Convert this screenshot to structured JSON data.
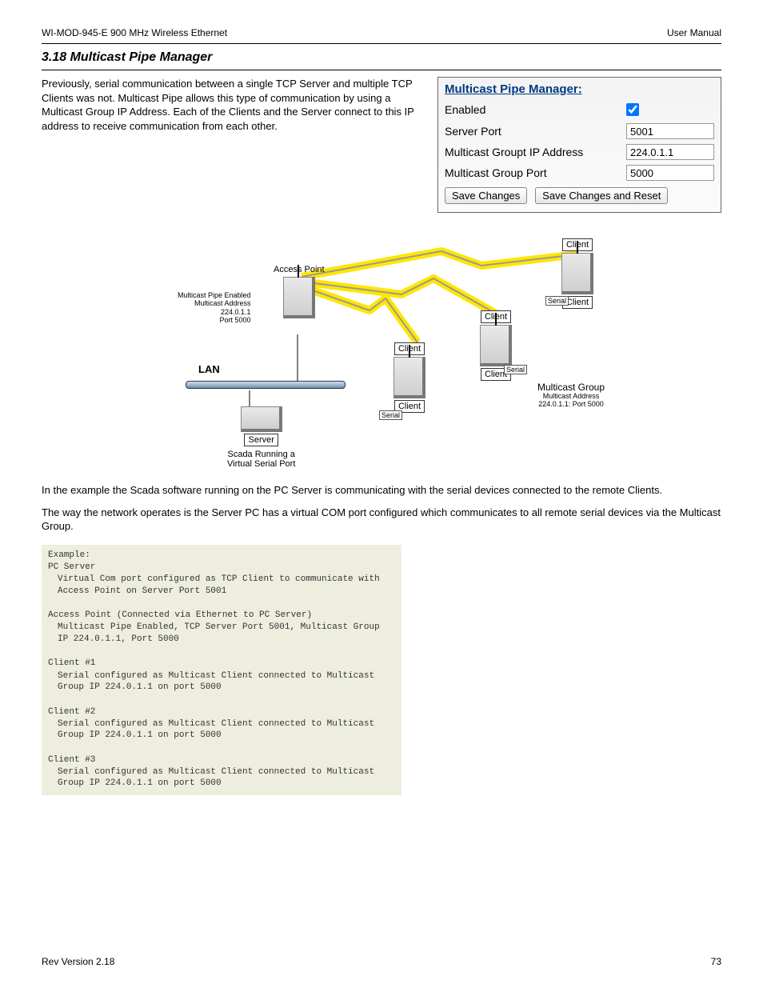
{
  "header": {
    "left": "WI-MOD-945-E 900 MHz Wireless Ethernet",
    "right": "User Manual"
  },
  "section_title": "3.18 Multicast Pipe Manager",
  "intro_para": "Previously, serial communication between a single TCP Server and multiple TCP Clients was not. Multicast Pipe allows this type of communication by using a Multicast Group IP Address. Each of the Clients and the Server connect to this IP address to receive communication from each other.",
  "config_panel": {
    "title": "Multicast Pipe Manager:",
    "enabled_label": "Enabled",
    "enabled_checked": true,
    "server_port_label": "Server Port",
    "server_port_value": "5001",
    "group_ip_label": "Multicast Groupt IP Address",
    "group_ip_value": "224.0.1.1",
    "group_port_label": "Multicast Group Port",
    "group_port_value": "5000",
    "save_label": "Save Changes",
    "save_reset_label": "Save Changes and Reset"
  },
  "notes": [
    "In the example the Scada software running on the PC Server is communicating with the serial devices connected to the remote Clients.",
    "The way the network operates is the Server PC has a virtual COM port configured which communicates to all remote serial devices via the Multicast Group."
  ],
  "diagram": {
    "access_point_label": "Access Point",
    "client_label": "Client",
    "server_label": "Server",
    "serial_label": "Serial",
    "lan_label": "LAN",
    "ap_caption": [
      "Multicast Pipe Enabled",
      "Multicast Address",
      "224.0.1.1",
      "Port 5000"
    ],
    "mc_group_title": "Multicast Group",
    "mc_group_caption": [
      "Multicast Address",
      "224.0.1.1: Port 5000"
    ],
    "server_caption": [
      "Scada Running a",
      "Virtual Serial Port"
    ]
  },
  "example": {
    "lines": [
      "Example:",
      "PC Server",
      "  Virtual Com port configured as TCP Client to communicate with Access Point on Server Port 5001",
      "",
      "Access Point (Connected via Ethernet to PC Server)",
      "  Multicast Pipe Enabled, TCP Server Port 5001, Multicast Group IP 224.0.1.1, Port 5000",
      "",
      "Client #1",
      "  Serial configured as Multicast Client connected to Multicast Group IP 224.0.1.1 on port 5000",
      "",
      "Client #2",
      "  Serial configured as Multicast Client connected to Multicast Group IP 224.0.1.1 on port 5000",
      "",
      "Client #3",
      "  Serial configured as Multicast Client connected to Multicast Group IP 224.0.1.1 on port 5000"
    ]
  },
  "footer": {
    "left": "Rev Version 2.18",
    "right": "73"
  }
}
